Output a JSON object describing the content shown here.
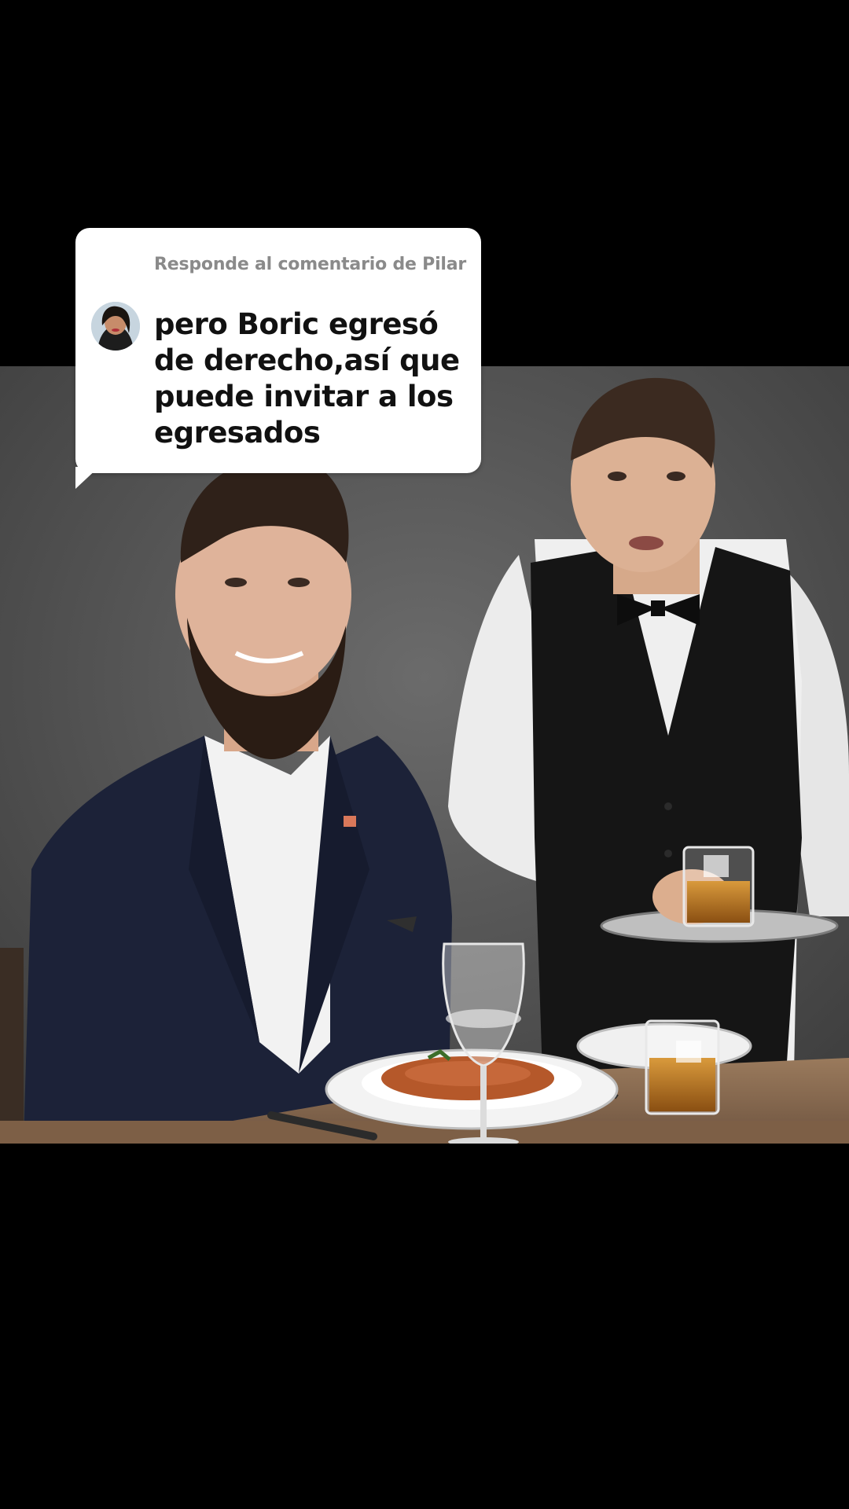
{
  "reply_sticker": {
    "header": "Responde al comentario de Pilar",
    "comment_text": "pero Boric egresó de derecho,así que puede invitar a los egresados",
    "avatar_icon": "user-avatar-icon",
    "background_color": "#ffffff",
    "header_color": "#8a8a8a",
    "text_color": "#111111"
  },
  "video": {
    "background_color": "#000000",
    "wall_color": "#5a5a5a",
    "table_color": "#8a6a4e"
  }
}
